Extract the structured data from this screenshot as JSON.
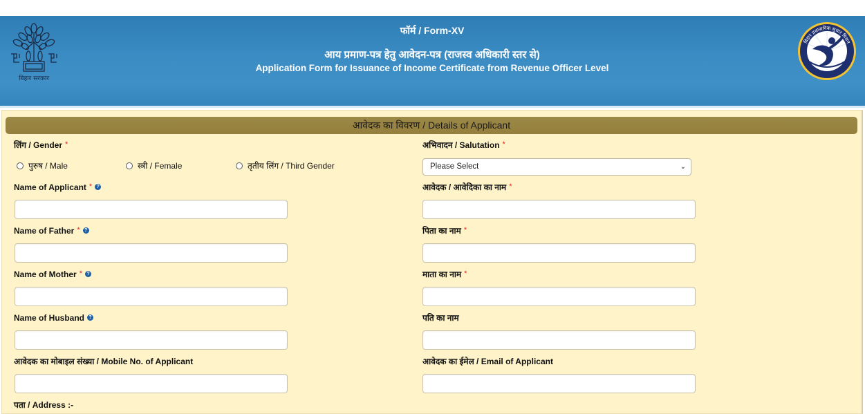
{
  "header": {
    "form_no": "फॉर्म / Form-XV",
    "title_hindi": "आय प्रमाण-पत्र हेतु आवेदन-पत्र (राजस्व अधिकारी स्तर से)",
    "title_english": "Application Form for Issuance of Income Certificate from Revenue Officer Level",
    "left_logo_caption": "बिहार सरकार",
    "left_logo_icon": "bihar-government-emblem",
    "right_logo_icon": "bihar-prashasnik-sudhar-mission-logo",
    "right_logo_text": "बिहार प्रशासनिक सुधार मिशन"
  },
  "section": {
    "title": "आवेदक का विवरण / Details of Applicant"
  },
  "form": {
    "gender": {
      "label": "लिंग / Gender",
      "required_mark": "*",
      "options": [
        {
          "label": "पुरुष / Male",
          "selected": false
        },
        {
          "label": "स्त्री / Female",
          "selected": false
        },
        {
          "label": "तृतीय लिंग / Third Gender",
          "selected": false
        }
      ]
    },
    "salutation": {
      "label": "अभिवादन / Salutation",
      "required_mark": "*",
      "selected": "Please Select"
    },
    "applicant_name_en": {
      "label": "Name of Applicant",
      "required_mark": "*",
      "help": "?",
      "value": ""
    },
    "applicant_name_hi": {
      "label": "आवेदक / आवेदिका का नाम",
      "required_mark": "*",
      "value": ""
    },
    "father_name_en": {
      "label": "Name of Father",
      "required_mark": "*",
      "help": "?",
      "value": ""
    },
    "father_name_hi": {
      "label": "पिता का नाम",
      "required_mark": "*",
      "value": ""
    },
    "mother_name_en": {
      "label": "Name of Mother",
      "required_mark": "*",
      "help": "?",
      "value": ""
    },
    "mother_name_hi": {
      "label": "माता का नाम",
      "required_mark": "*",
      "value": ""
    },
    "husband_name_en": {
      "label": "Name of Husband",
      "help": "?",
      "value": ""
    },
    "husband_name_hi": {
      "label": "पति का नाम",
      "value": ""
    },
    "mobile": {
      "label": "आवेदक का मोबाइल संख्या / Mobile No. of Applicant",
      "value": ""
    },
    "email": {
      "label": "आवेदक का ईमेल / Email of Applicant",
      "value": ""
    },
    "address": {
      "label": "पता / Address :-"
    }
  },
  "colors": {
    "header_blue": "#3b8cc4",
    "panel_bg": "#fff4c9",
    "section_bar": "#9c8946",
    "required_red": "#dd2222",
    "help_blue": "#1e5fa5"
  }
}
